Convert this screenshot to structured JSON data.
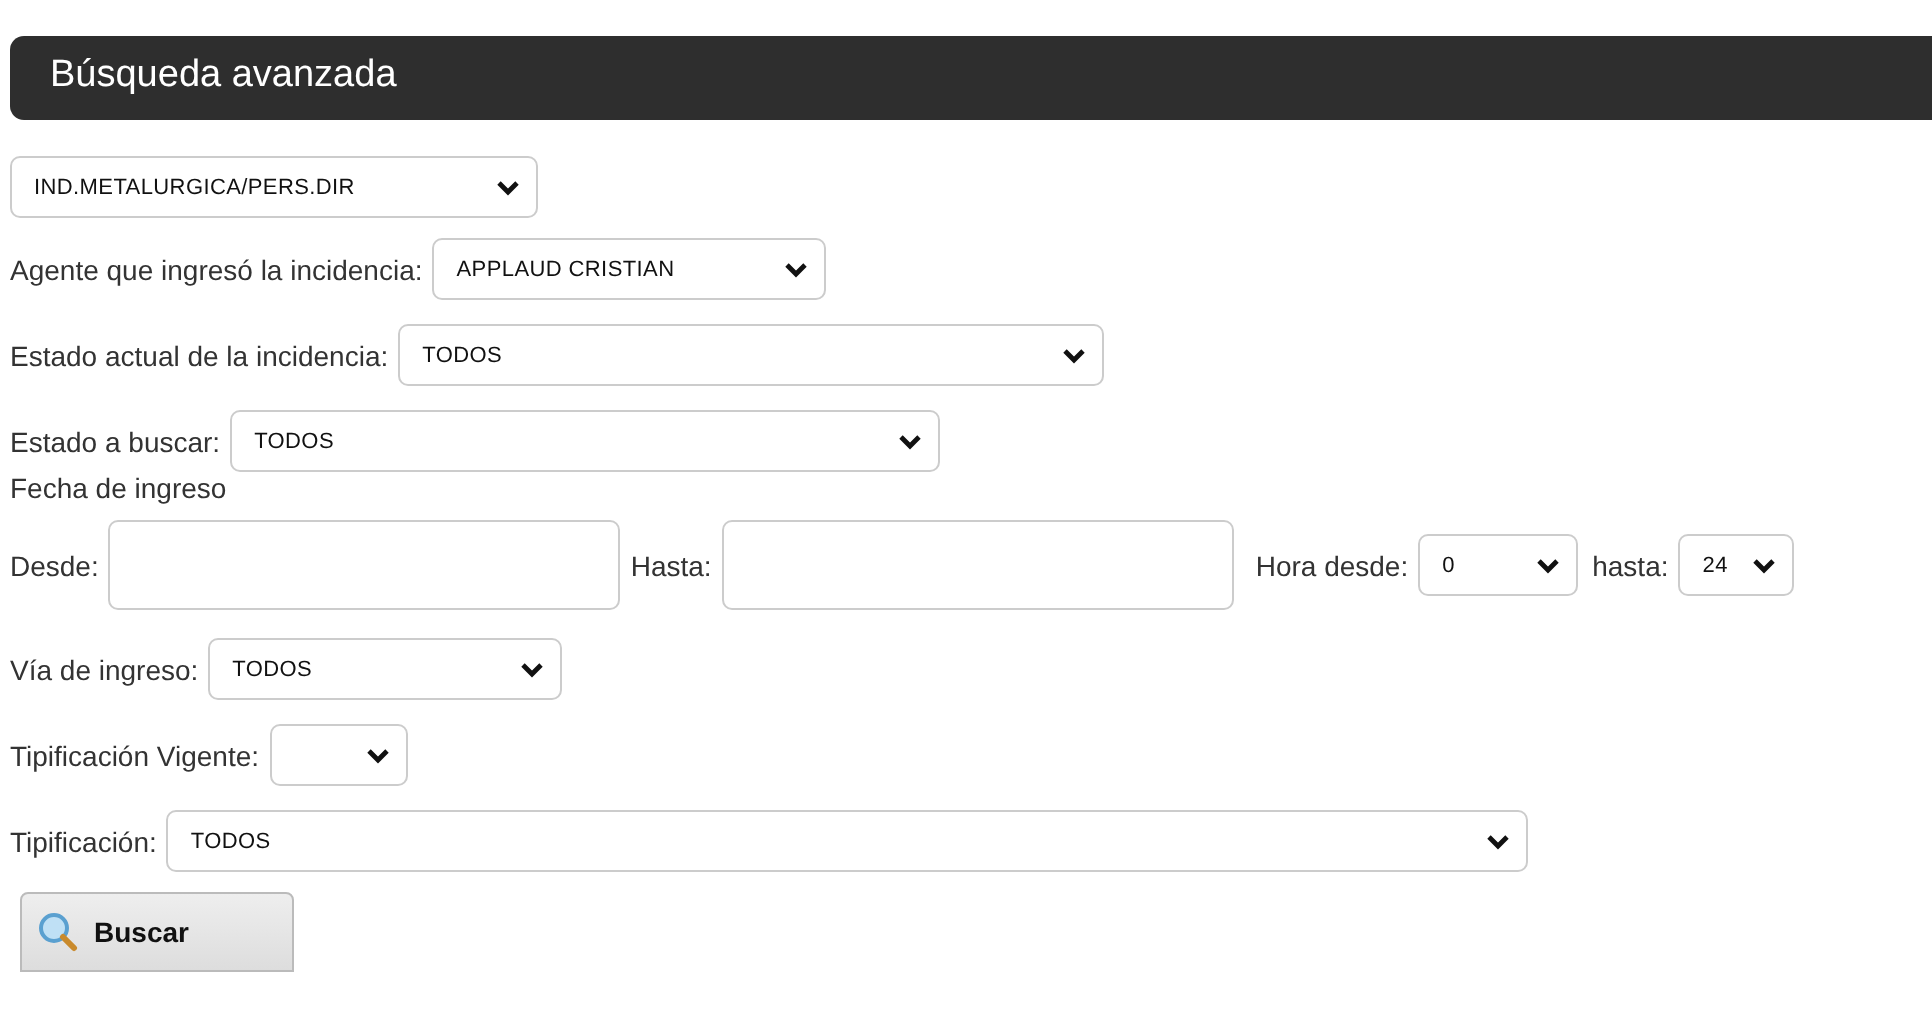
{
  "header": {
    "title": "Búsqueda avanzada"
  },
  "rows": [
    {
      "kind": "select",
      "value": "IND.METALURGICA/PERS.DIR"
    },
    {
      "kind": "select",
      "label": "Agente que ingresó la incidencia:",
      "value": "APPLAUD CRISTIAN"
    },
    {
      "kind": "select",
      "label": "Estado actual de la incidencia:",
      "value": "TODOS"
    },
    {
      "kind": "select",
      "label": "Estado a buscar:",
      "value": "TODOS"
    },
    {
      "kind": "text",
      "label": "Fecha de ingreso"
    },
    {
      "kind": "dates",
      "from_label": "Desde:",
      "to_label": "Hasta:",
      "hour_from_label": "Hora desde:",
      "hour_from_value": "0",
      "hour_to_label": "hasta:",
      "hour_to_value": "24"
    },
    {
      "kind": "select",
      "label": "Vía de ingreso:",
      "value": "TODOS"
    },
    {
      "kind": "select",
      "label": "Tipificación Vigente:"
    },
    {
      "kind": "select",
      "label": "Tipificación:",
      "value": "TODOS"
    }
  ],
  "button": {
    "label": "Buscar"
  }
}
